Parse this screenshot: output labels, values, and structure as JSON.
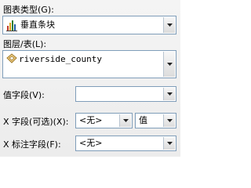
{
  "chart_type": {
    "label": "图表类型(G):",
    "value": "垂直条块",
    "icon": "bar-chart-icon"
  },
  "layer": {
    "label": "图层/表(L):",
    "value": "riverside_county",
    "icon": "layer-polygon-icon"
  },
  "value_field": {
    "label": "值字段(V):",
    "value": ""
  },
  "x_field": {
    "label": "X 字段(可选)(X):",
    "value": "<无>",
    "sort_value": "值"
  },
  "x_label_field": {
    "label": "X 标注字段(F):",
    "value": "<无>"
  }
}
